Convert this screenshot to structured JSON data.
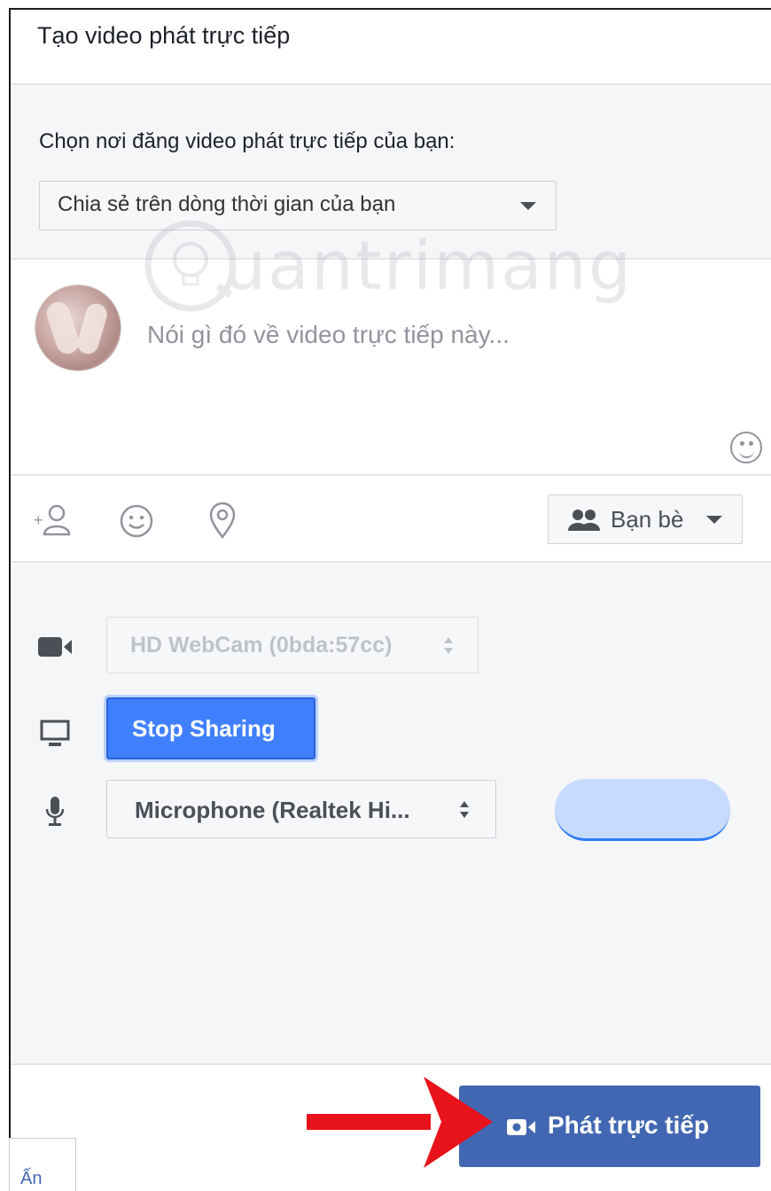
{
  "dialog": {
    "title": "Tạo video phát trực tiếp"
  },
  "destination": {
    "label": "Chọn nơi đăng video phát trực tiếp của bạn:",
    "selected": "Chia sẻ trên dòng thời gian của bạn"
  },
  "composer": {
    "placeholder": "Nói gì đó về video trực tiếp này..."
  },
  "toolbar": {
    "audience_label": "Bạn bè",
    "icons": [
      "tag-friends-icon",
      "feeling-icon",
      "location-icon",
      "friends-icon"
    ]
  },
  "settings": {
    "camera_label": "HD WebCam (0bda:57cc)",
    "screen_button_label": "Stop Sharing",
    "microphone_label": "Microphone (Realtek Hi...",
    "icons": [
      "video-camera-icon",
      "monitor-icon",
      "microphone-icon"
    ]
  },
  "footer": {
    "go_live_label": "Phát trực tiếp"
  },
  "corner_tab": {
    "label": "Ấn"
  },
  "watermark": {
    "text": "uantrimang"
  },
  "colors": {
    "primary_button": "#4267b2",
    "stop_sharing": "#4080ff",
    "arrow": "#e8121b",
    "panel_bg": "#f5f6f8"
  }
}
